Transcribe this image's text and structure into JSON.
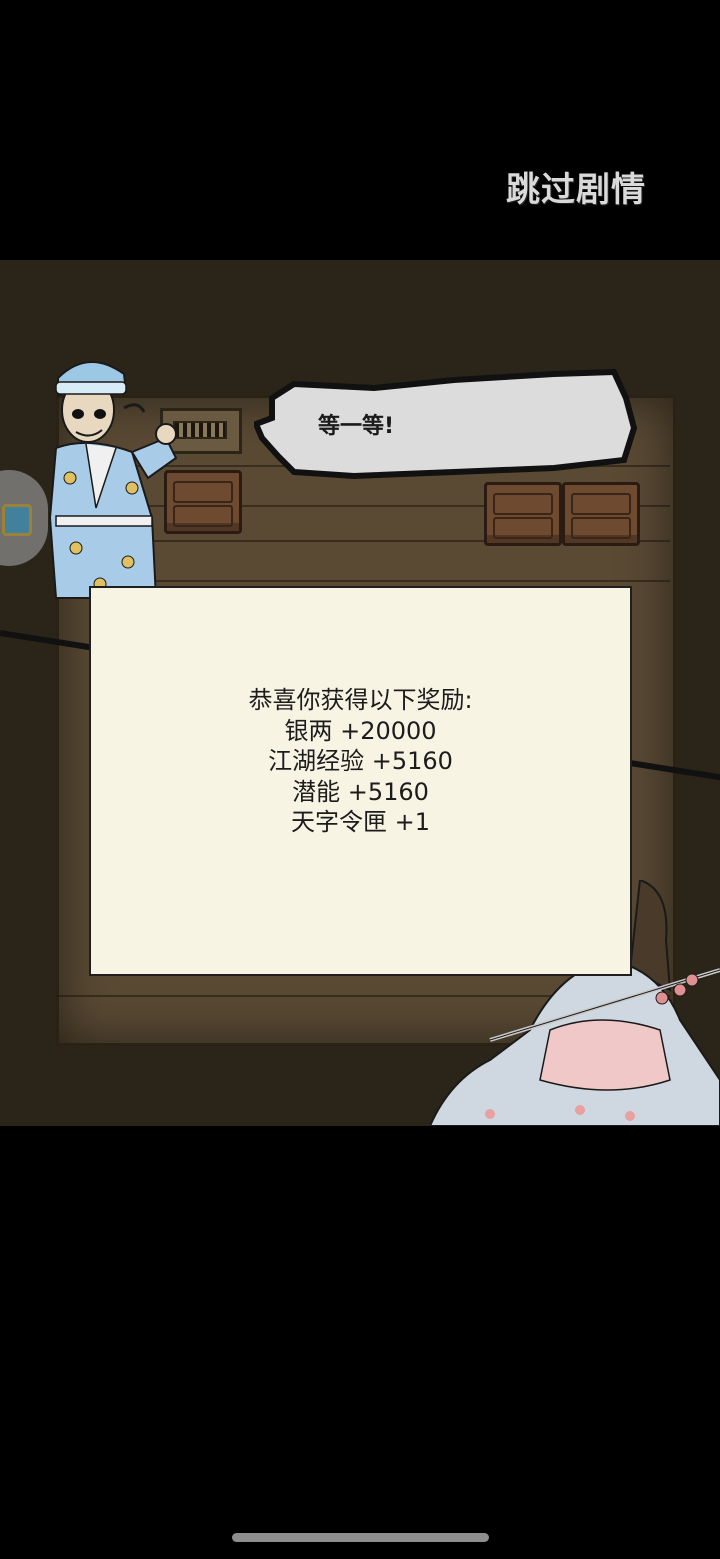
{
  "top_bar": {
    "skip_label": "跳过剧情"
  },
  "dialogue": {
    "text": "等一等!"
  },
  "reward_panel": {
    "title": "恭喜你获得以下奖励:",
    "items": [
      "银两 +20000",
      "江湖经验 +5160",
      "潜能 +5160",
      "天字令匣 +1"
    ]
  },
  "characters": {
    "left": "servant-man-character",
    "right": "swordswoman-character"
  },
  "colors": {
    "background": "#000000",
    "panel": "#f8f4e4",
    "wood": "#5a4a34",
    "skip_text": "#d9d9d9"
  }
}
